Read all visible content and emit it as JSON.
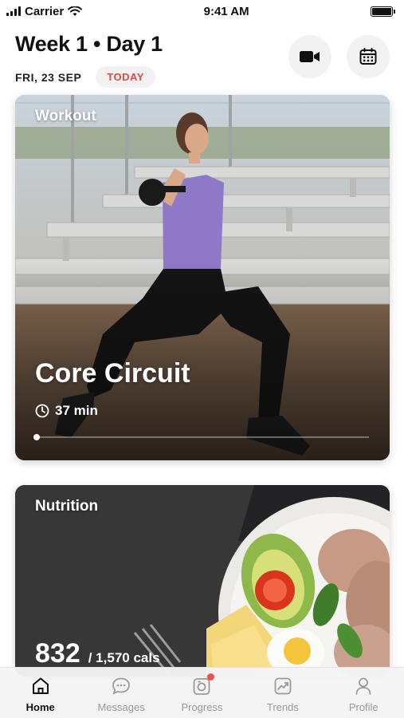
{
  "status_bar": {
    "carrier": "Carrier",
    "time": "9:41 AM"
  },
  "header": {
    "title": "Week 1 • Day 1",
    "date": "FRI, 23 SEP",
    "today_badge": "TODAY",
    "today_color": "#e04848",
    "icons": [
      "video-camera-icon",
      "calendar-icon"
    ]
  },
  "workout": {
    "label": "Workout",
    "title": "Core Circuit",
    "duration": "37 min",
    "progress": 0
  },
  "nutrition": {
    "label": "Nutrition",
    "calories": "832",
    "calories_total": "/ 1,570 cals"
  },
  "tabs": [
    {
      "label": "Home",
      "icon": "home-icon",
      "active": true
    },
    {
      "label": "Messages",
      "icon": "messages-icon",
      "active": false
    },
    {
      "label": "Progress",
      "icon": "progress-camera-icon",
      "active": false,
      "badge_color": "#ec5050"
    },
    {
      "label": "Trends",
      "icon": "trends-icon",
      "active": false
    },
    {
      "label": "Profile",
      "icon": "profile-icon",
      "active": false
    }
  ]
}
